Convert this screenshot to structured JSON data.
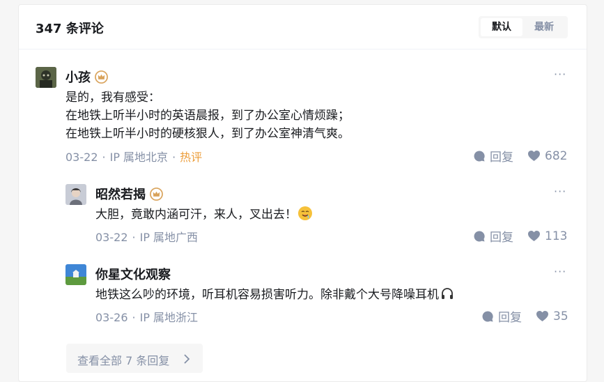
{
  "header": {
    "count_title": "347 条评论",
    "sort_default": "默认",
    "sort_latest": "最新"
  },
  "comments": [
    {
      "author": "小孩",
      "lines": [
        "是的，我有感受：",
        "在地铁上听半小时的英语晨报，到了办公室心情烦躁；",
        "在地铁上听半小时的硬核狠人，到了办公室神清气爽。"
      ],
      "date": "03-22",
      "location": "IP 属地北京",
      "tag": "热评",
      "reply_label": "回复",
      "likes": "682"
    },
    {
      "author": "昭然若揭",
      "text": "大胆，竟敢内涵可汗，来人，叉出去！",
      "date": "03-22",
      "location": "IP 属地广西",
      "reply_label": "回复",
      "likes": "113"
    },
    {
      "author": "你星文化观察",
      "text": "地铁这么吵的环境，听耳机容易损害听力。除非戴个大号降噪耳机",
      "date": "03-26",
      "location": "IP 属地浙江",
      "reply_label": "回复",
      "likes": "35"
    }
  ],
  "view_all_label": "查看全部 7 条回复",
  "more_label": "···",
  "meta_separator": "·",
  "colors": {
    "hot": "#ec9d3a",
    "meta": "#8590a6",
    "badge": "#d9a35b"
  }
}
